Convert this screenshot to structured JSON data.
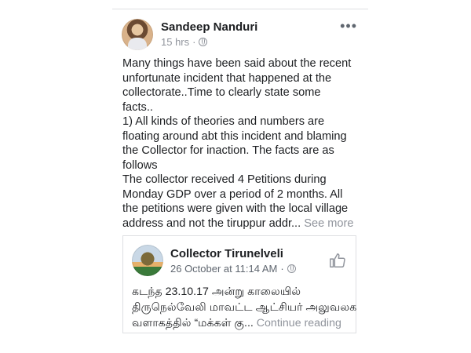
{
  "post": {
    "author": "Sandeep Nanduri",
    "timestamp": "15 hrs",
    "separator": "·",
    "privacy_icon": "globe-icon",
    "more_icon": "more-options-icon",
    "body_lines": [
      "Many things have been said about the recent",
      "unfortunate incident that happened at the",
      "collectorate..Time to clearly state some",
      "facts..",
      "1) All kinds of theories and numbers are",
      "floating  around abt this incident and blaming",
      "the Collector for inaction. The facts are as",
      "follows",
      "The collector received 4 Petitions during",
      "Monday GDP over a period of 2 months. All",
      "the petitions were given with the local village"
    ],
    "body_last_line": "address and not the tiruppur addr...",
    "see_more": "See more"
  },
  "shared": {
    "author": "Collector Tirunelveli",
    "timestamp": "26 October at 11:14 AM",
    "separator": "·",
    "privacy_icon": "globe-icon",
    "like_icon": "thumbs-up-icon",
    "text_lines": [
      "கடந்த 23.10.17 அன்று காலையில்",
      "திருநெல்வேலி மாவட்ட ஆட்சியர் அலுவலக"
    ],
    "text_last_line": "வளாகத்தில் “மக்கள் கு...",
    "continue_reading": "Continue reading"
  },
  "colors": {
    "text": "#1c1e21",
    "muted": "#90949c",
    "border": "#dddfe2"
  }
}
